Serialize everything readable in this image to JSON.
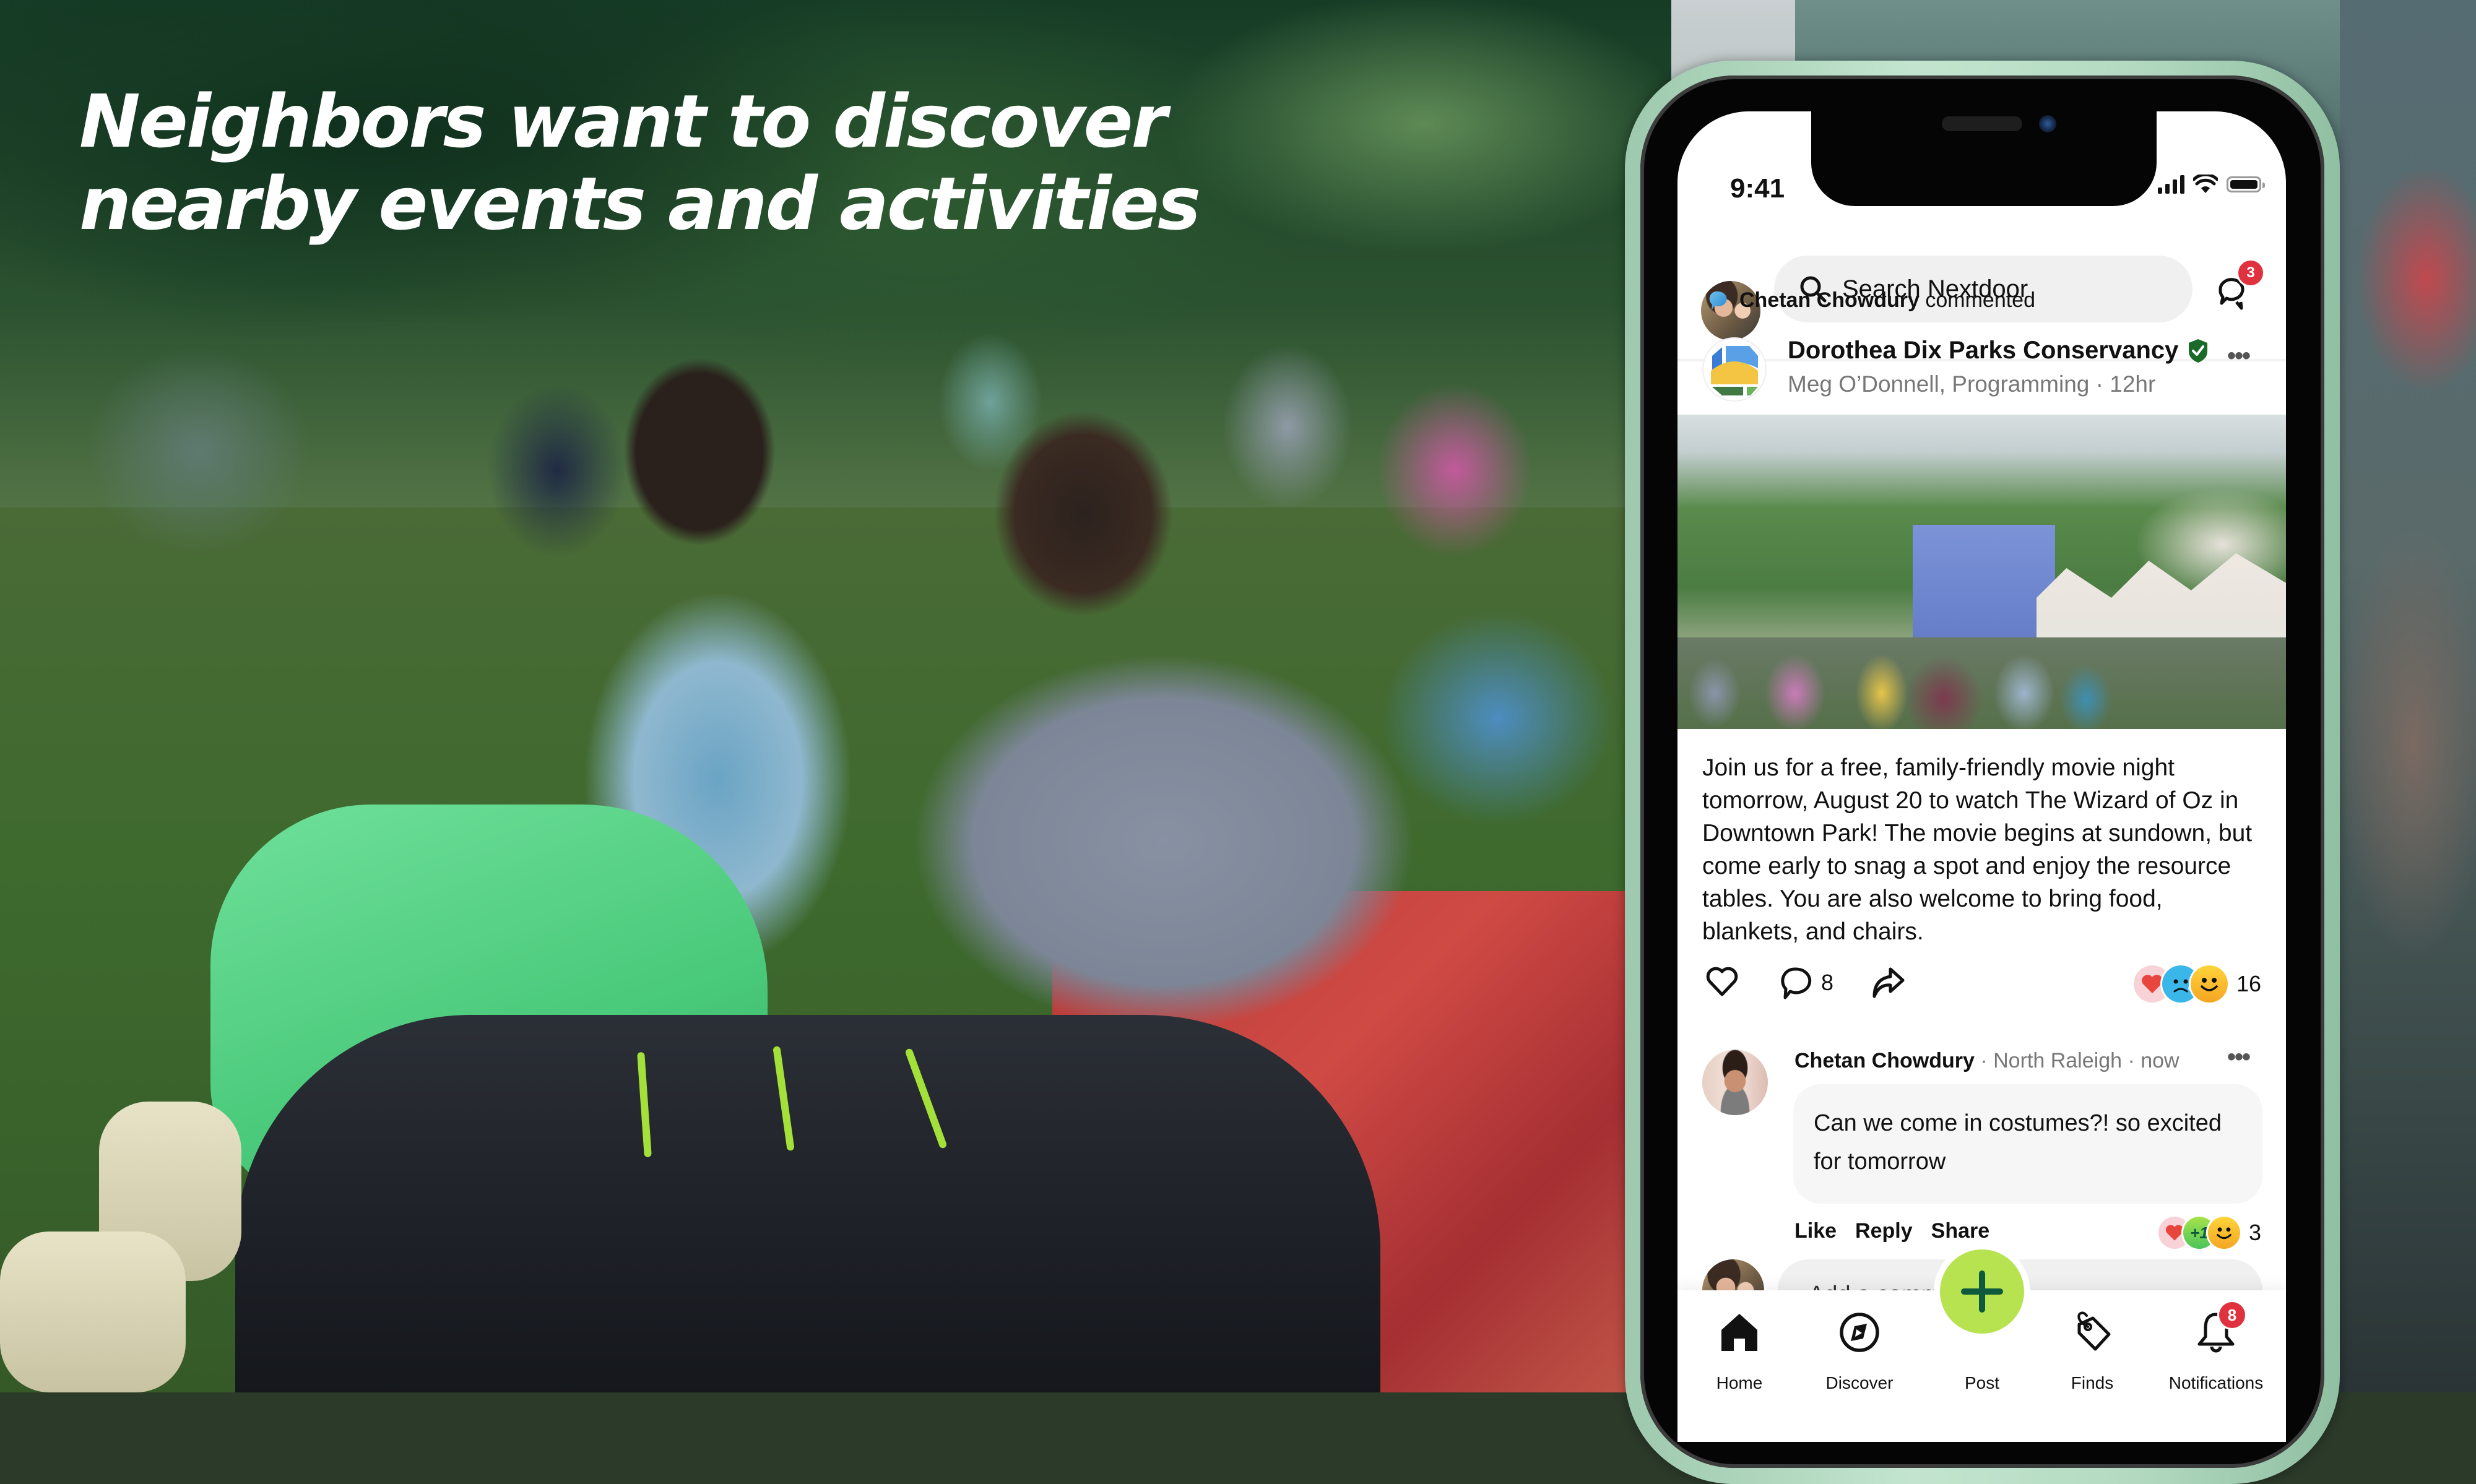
{
  "headline": {
    "line1": "Neighbors want to discover",
    "line2": "nearby events and activities"
  },
  "status_bar": {
    "time": "9:41"
  },
  "header": {
    "search_placeholder": "Search Nextdoor",
    "messages_badge": "3"
  },
  "activity": {
    "actor": "Chetan Chowdury",
    "action": "commented"
  },
  "post": {
    "author": "Dorothea Dix Parks Conservancy",
    "verified": true,
    "subtitle": "Meg O’Donnell, Programming · 12hr",
    "more": "•••",
    "body": "Join us for a free, family-friendly movie night tomorrow, August 20 to watch The Wizard of Oz in Downtown Park! The movie begins at sundown, but come early to snag a spot and enjoy the resource tables. You are also welcome to bring food, blankets, and chairs.",
    "comment_count": "8",
    "reactions": [
      "heart",
      "sad",
      "smile"
    ],
    "reaction_count": "16"
  },
  "comment": {
    "author": "Chetan Chowdury",
    "meta": " · North Raleigh · now",
    "more": "•••",
    "text": "Can we come in costumes?! so excited for tomorrow",
    "actions": {
      "like": "Like",
      "reply": "Reply",
      "share": "Share"
    },
    "reactions": [
      "heart",
      "plus-one",
      "smile"
    ],
    "plus_one_label": "+1",
    "reaction_count": "3"
  },
  "composer": {
    "placeholder": "Add a comment"
  },
  "bottom_nav": {
    "items": [
      {
        "label": "Home",
        "icon": "home-icon"
      },
      {
        "label": "Discover",
        "icon": "compass-icon"
      },
      {
        "label": "Post",
        "icon": "plus-icon"
      },
      {
        "label": "Finds",
        "icon": "tag-icon"
      },
      {
        "label": "Notifications",
        "icon": "bell-icon"
      }
    ],
    "notifications_badge": "8"
  },
  "colors": {
    "accent_green": "#b6e34f",
    "plus_green": "#0f5a3c",
    "badge_red": "#e0313f",
    "verified_green": "#1a6b2a",
    "phone_frame": "#b4dbc2"
  }
}
